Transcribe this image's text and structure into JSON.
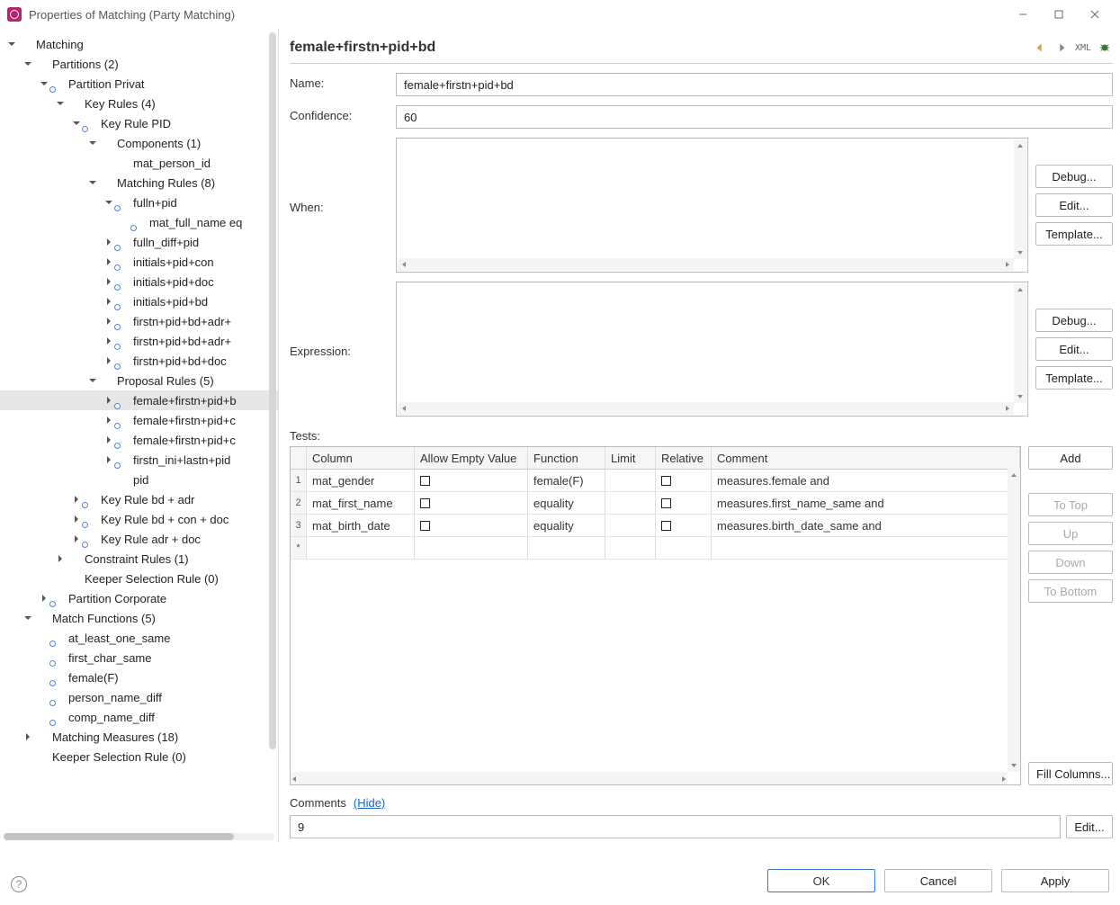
{
  "window": {
    "title": "Properties of Matching (Party Matching)"
  },
  "tree": [
    {
      "d": 0,
      "t": "down",
      "i": "dot-blue",
      "l": "Matching"
    },
    {
      "d": 1,
      "t": "down",
      "i": "dot-blue",
      "l": "Partitions (2)"
    },
    {
      "d": 2,
      "t": "down",
      "i": "dot-link",
      "l": "Partition Privat"
    },
    {
      "d": 3,
      "t": "down",
      "i": "dot-blue",
      "l": "Key Rules (4)"
    },
    {
      "d": 4,
      "t": "down",
      "i": "dot-link",
      "l": "Key Rule PID"
    },
    {
      "d": 5,
      "t": "down",
      "i": "dot-blue",
      "l": "Components (1)"
    },
    {
      "d": 6,
      "t": "none",
      "i": "dot-blue",
      "l": "mat_person_id"
    },
    {
      "d": 5,
      "t": "down",
      "i": "dot-blue",
      "l": "Matching Rules (8)"
    },
    {
      "d": 6,
      "t": "down",
      "i": "dot-link",
      "l": "fulln+pid"
    },
    {
      "d": 7,
      "t": "none",
      "i": "dot-link",
      "l": "mat_full_name eq"
    },
    {
      "d": 6,
      "t": "right",
      "i": "dot-link",
      "l": "fulln_diff+pid"
    },
    {
      "d": 6,
      "t": "right",
      "i": "dot-link",
      "l": "initials+pid+con"
    },
    {
      "d": 6,
      "t": "right",
      "i": "dot-link",
      "l": "initials+pid+doc"
    },
    {
      "d": 6,
      "t": "right",
      "i": "dot-link",
      "l": "initials+pid+bd"
    },
    {
      "d": 6,
      "t": "right",
      "i": "dot-link",
      "l": "firstn+pid+bd+adr+"
    },
    {
      "d": 6,
      "t": "right",
      "i": "dot-link",
      "l": "firstn+pid+bd+adr+"
    },
    {
      "d": 6,
      "t": "right",
      "i": "dot-link",
      "l": "firstn+pid+bd+doc"
    },
    {
      "d": 5,
      "t": "down",
      "i": "dot-blue",
      "l": "Proposal Rules (5)"
    },
    {
      "d": 6,
      "t": "right",
      "i": "dot-link",
      "l": "female+firstn+pid+b",
      "sel": true
    },
    {
      "d": 6,
      "t": "right",
      "i": "dot-link",
      "l": "female+firstn+pid+c"
    },
    {
      "d": 6,
      "t": "right",
      "i": "dot-link",
      "l": "female+firstn+pid+c"
    },
    {
      "d": 6,
      "t": "right",
      "i": "dot-link",
      "l": "firstn_ini+lastn+pid"
    },
    {
      "d": 6,
      "t": "none",
      "i": "dot-blue",
      "l": "pid"
    },
    {
      "d": 4,
      "t": "right",
      "i": "dot-link",
      "l": "Key Rule bd + adr"
    },
    {
      "d": 4,
      "t": "right",
      "i": "dot-link",
      "l": "Key Rule bd + con + doc"
    },
    {
      "d": 4,
      "t": "right",
      "i": "dot-link",
      "l": "Key Rule adr + doc"
    },
    {
      "d": 3,
      "t": "right",
      "i": "dot-blue",
      "l": "Constraint Rules (1)"
    },
    {
      "d": 3,
      "t": "none",
      "i": "dot-blue",
      "l": "Keeper Selection Rule (0)"
    },
    {
      "d": 2,
      "t": "right",
      "i": "dot-link",
      "l": "Partition Corporate"
    },
    {
      "d": 1,
      "t": "down",
      "i": "dot-blue",
      "l": "Match Functions (5)"
    },
    {
      "d": 2,
      "t": "none",
      "i": "dot-link",
      "l": "at_least_one_same"
    },
    {
      "d": 2,
      "t": "none",
      "i": "dot-link",
      "l": "first_char_same"
    },
    {
      "d": 2,
      "t": "none",
      "i": "dot-link",
      "l": "female(F)"
    },
    {
      "d": 2,
      "t": "none",
      "i": "dot-link",
      "l": "person_name_diff"
    },
    {
      "d": 2,
      "t": "none",
      "i": "dot-link",
      "l": "comp_name_diff"
    },
    {
      "d": 1,
      "t": "right",
      "i": "dot-blue",
      "l": "Matching Measures (18)"
    },
    {
      "d": 1,
      "t": "none",
      "i": "dot-blue",
      "l": "Keeper Selection Rule (0)"
    }
  ],
  "panel": {
    "title": "female+firstn+pid+bd",
    "labels": {
      "name": "Name:",
      "confidence": "Confidence:",
      "when": "When:",
      "expression": "Expression:",
      "tests": "Tests:",
      "comments": "Comments",
      "hide": "(Hide)"
    },
    "fields": {
      "name": "female+firstn+pid+bd",
      "confidence": "60",
      "comments": "9"
    },
    "buttons": {
      "debug": "Debug...",
      "edit": "Edit...",
      "template": "Template...",
      "add": "Add",
      "toTop": "To Top",
      "up": "Up",
      "down": "Down",
      "toBottom": "To Bottom",
      "fillColumns": "Fill Columns...",
      "editComment": "Edit..."
    },
    "tests": {
      "headers": {
        "column": "Column",
        "allowEmpty": "Allow Empty Value",
        "function": "Function",
        "limit": "Limit",
        "relative": "Relative",
        "comment": "Comment"
      },
      "rows": [
        {
          "n": "1",
          "column": "mat_gender",
          "allowEmpty": false,
          "function": "female(F)",
          "limit": "",
          "relative": false,
          "comment": "measures.female and"
        },
        {
          "n": "2",
          "column": "mat_first_name",
          "allowEmpty": false,
          "function": "equality",
          "limit": "",
          "relative": false,
          "comment": "measures.first_name_same and"
        },
        {
          "n": "3",
          "column": "mat_birth_date",
          "allowEmpty": false,
          "function": "equality",
          "limit": "",
          "relative": false,
          "comment": "measures.birth_date_same and"
        }
      ],
      "newRowMarker": "*"
    },
    "xmlLabel": "XML"
  },
  "footer": {
    "ok": "OK",
    "cancel": "Cancel",
    "apply": "Apply"
  }
}
